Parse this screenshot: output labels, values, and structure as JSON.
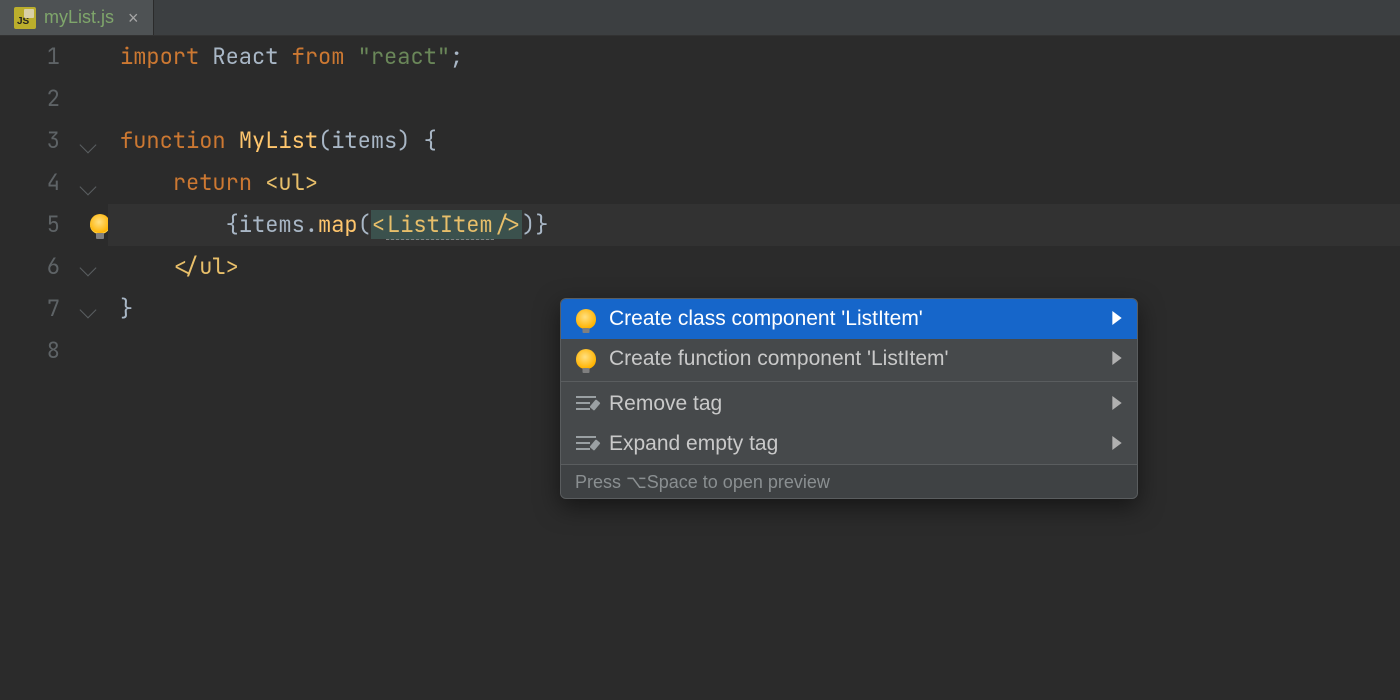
{
  "tab": {
    "filename": "myList.js",
    "filetype_label": "JS"
  },
  "gutter": {
    "line_numbers": [
      "1",
      "2",
      "3",
      "4",
      "5",
      "6",
      "7",
      "8"
    ]
  },
  "code": {
    "l1": {
      "import": "import",
      "react": "React",
      "from": "from",
      "str": "\"react\"",
      "semi": ";"
    },
    "l3": {
      "function": "function",
      "name": "MyList",
      "rest": "(items) {"
    },
    "l4": {
      "return": "return",
      "open": "<",
      "tag": "ul",
      "close": ">"
    },
    "l5": {
      "pre": "        {items.",
      "map": "map",
      "lp": "(",
      "lt": "<",
      "comp": "ListItem",
      "slash": "/>",
      "rp": ")}"
    },
    "l6": {
      "open": "</",
      "tag": "ul",
      "close": ">"
    },
    "l7": {
      "text": "}"
    }
  },
  "popup": {
    "items": [
      {
        "label": "Create class component 'ListItem'",
        "icon": "bulb",
        "selected": true,
        "submenu": true
      },
      {
        "label": "Create function component 'ListItem'",
        "icon": "bulb",
        "selected": false,
        "submenu": true
      },
      {
        "label": "Remove tag",
        "icon": "tag-action",
        "selected": false,
        "submenu": true
      },
      {
        "label": "Expand empty tag",
        "icon": "tag-action",
        "selected": false,
        "submenu": true
      }
    ],
    "footer": "Press ⌥Space to open preview"
  }
}
